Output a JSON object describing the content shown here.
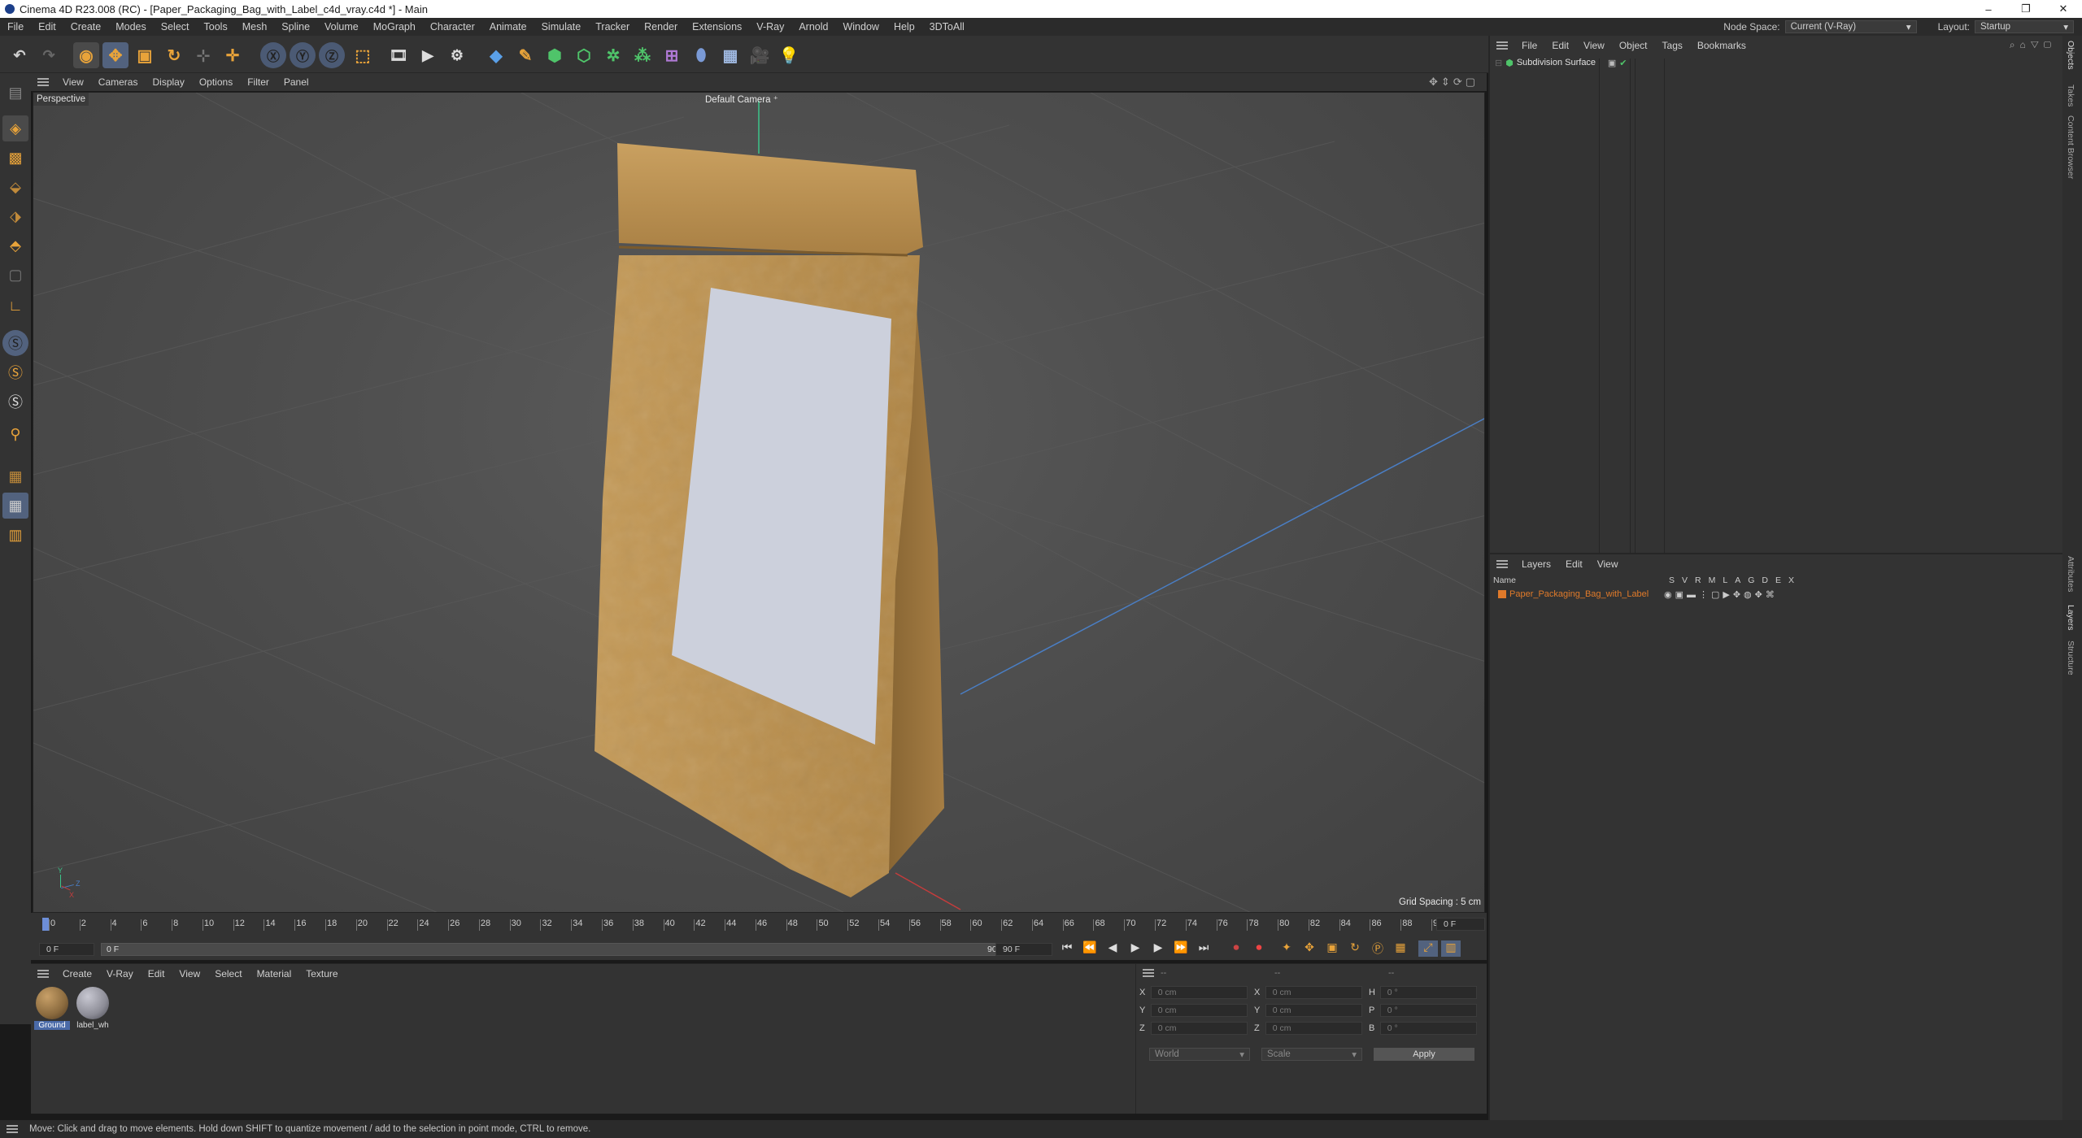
{
  "window": {
    "title": "Cinema 4D R23.008 (RC) - [Paper_Packaging_Bag_with_Label_c4d_vray.c4d *] - Main",
    "minimize": "–",
    "maximize": "❐",
    "close": "✕"
  },
  "menubar": {
    "items": [
      "File",
      "Edit",
      "Create",
      "Modes",
      "Select",
      "Tools",
      "Mesh",
      "Spline",
      "Volume",
      "MoGraph",
      "Character",
      "Animate",
      "Simulate",
      "Tracker",
      "Render",
      "Extensions",
      "V-Ray",
      "Arnold",
      "Window",
      "Help",
      "3DToAll"
    ],
    "node_space_label": "Node Space:",
    "node_space_value": "Current (V-Ray)",
    "layout_label": "Layout:",
    "layout_value": "Startup"
  },
  "viewport": {
    "menu": [
      "View",
      "Cameras",
      "Display",
      "Options",
      "Filter",
      "Panel"
    ],
    "view_name": "Perspective",
    "camera": "Default Camera",
    "grid_spacing": "Grid Spacing : 5 cm",
    "axis": {
      "y": "Y",
      "z": "Z",
      "x": "X"
    }
  },
  "timeline": {
    "ticks": [
      "0",
      "2",
      "4",
      "6",
      "8",
      "10",
      "12",
      "14",
      "16",
      "18",
      "20",
      "22",
      "24",
      "26",
      "28",
      "30",
      "32",
      "34",
      "36",
      "38",
      "40",
      "42",
      "44",
      "46",
      "48",
      "50",
      "52",
      "54",
      "56",
      "58",
      "60",
      "62",
      "64",
      "66",
      "68",
      "70",
      "72",
      "74",
      "76",
      "78",
      "80",
      "82",
      "84",
      "86",
      "88",
      "90"
    ],
    "current_frame": "0 F",
    "start_frame": "0 F",
    "range_start": "0 F",
    "range_end": "90 F",
    "end_frame": "90 F"
  },
  "materials": {
    "menu": [
      "Create",
      "V-Ray",
      "Edit",
      "View",
      "Select",
      "Material",
      "Texture"
    ],
    "items": [
      {
        "label": "Ground",
        "color": "#8a6a3e"
      },
      {
        "label": "label_wh",
        "color": "#8c8c96"
      }
    ]
  },
  "coordinates": {
    "header": [
      "--",
      "--",
      "--"
    ],
    "rows": [
      {
        "axis": "X",
        "pos": "0 cm",
        "axis2": "X",
        "size": "0 cm",
        "axis3": "H",
        "rot": "0 °"
      },
      {
        "axis": "Y",
        "pos": "0 cm",
        "axis2": "Y",
        "size": "0 cm",
        "axis3": "P",
        "rot": "0 °"
      },
      {
        "axis": "Z",
        "pos": "0 cm",
        "axis2": "Z",
        "size": "0 cm",
        "axis3": "B",
        "rot": "0 °"
      }
    ],
    "mode": "World",
    "transform": "Scale",
    "apply": "Apply"
  },
  "objects": {
    "menu": [
      "File",
      "Edit",
      "View",
      "Object",
      "Tags",
      "Bookmarks"
    ],
    "items": [
      {
        "name": "Subdivision Surface"
      }
    ]
  },
  "layers": {
    "menu": [
      "Layers",
      "Edit",
      "View"
    ],
    "name_header": "Name",
    "col_headers": [
      "S",
      "V",
      "R",
      "M",
      "L",
      "A",
      "G",
      "D",
      "E",
      "X"
    ],
    "items": [
      {
        "name": "Paper_Packaging_Bag_with_Label",
        "color": "#e07a2a"
      }
    ]
  },
  "side_tabs": {
    "top": [
      "Objects",
      "Takes",
      "Content Browser"
    ],
    "bottom": [
      "Attributes",
      "Layers",
      "Structure"
    ]
  },
  "status": "Move: Click and drag to move elements. Hold down SHIFT to quantize movement / add to the selection in point mode, CTRL to remove.",
  "colors": {
    "accent_orange": "#e8a33a",
    "select_blue": "#8aa6d6",
    "layer_text": "#e07a2a"
  }
}
